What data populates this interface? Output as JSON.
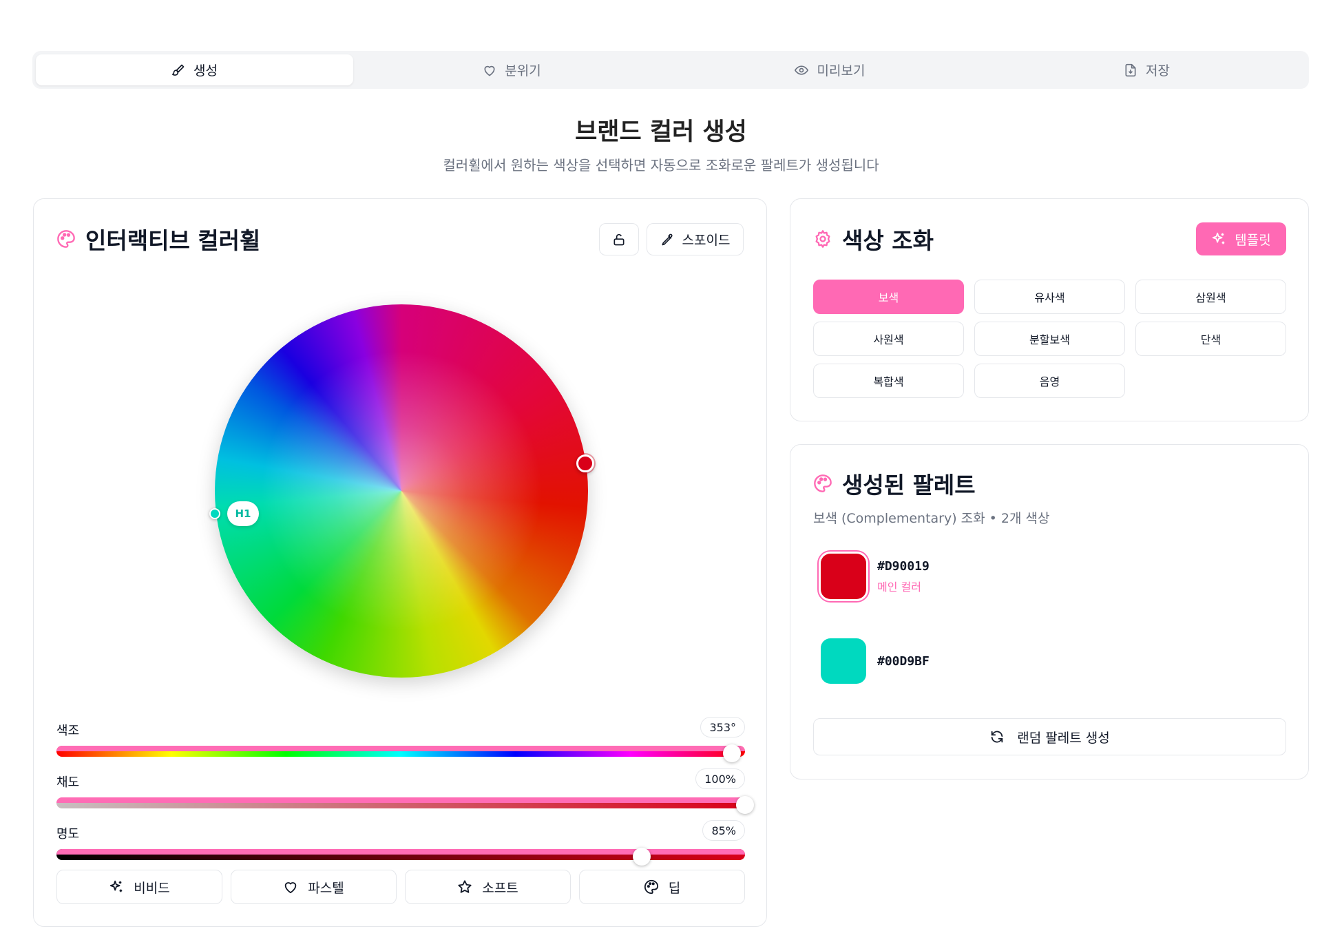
{
  "tabs": [
    {
      "label": "생성",
      "icon": "brush-icon",
      "active": true
    },
    {
      "label": "분위기",
      "icon": "heart-icon",
      "active": false
    },
    {
      "label": "미리보기",
      "icon": "eye-icon",
      "active": false
    },
    {
      "label": "저장",
      "icon": "file-download-icon",
      "active": false
    }
  ],
  "header": {
    "title": "브랜드 컬러 생성",
    "subtitle": "컬러휠에서 원하는 색상을 선택하면 자동으로 조화로운 팔레트가 생성됩니다"
  },
  "wheel_card": {
    "title": "인터랙티브 컬러휠",
    "picker_label": "스포이드",
    "secondary_marker_label": "H1",
    "sliders": {
      "hue": {
        "label": "색조",
        "value_text": "353°",
        "value": 353,
        "max": 360
      },
      "saturation": {
        "label": "채도",
        "value_text": "100%",
        "value": 100,
        "max": 100
      },
      "lightness": {
        "label": "명도",
        "value_text": "85%",
        "value": 85,
        "max": 100
      }
    },
    "presets": [
      "비비드",
      "파스텔",
      "소프트",
      "딥"
    ]
  },
  "harmony_card": {
    "title": "색상 조화",
    "template_label": "템플릿",
    "options": [
      "보색",
      "유사색",
      "삼원색",
      "사원색",
      "분할보색",
      "단색",
      "복합색",
      "음영"
    ],
    "selected": "보색"
  },
  "palette_card": {
    "title": "생성된 팔레트",
    "subtitle": "보색 (Complementary) 조화 • 2개 색상",
    "colors": [
      {
        "hex": "#D90019",
        "sublabel": "메인 컬러"
      },
      {
        "hex": "#00D9BF",
        "sublabel": ""
      }
    ],
    "random_label": "랜덤 팔레트 생성"
  },
  "colors": {
    "accent": "#ff69b4",
    "main": "#D90019",
    "complement": "#00D9BF"
  }
}
